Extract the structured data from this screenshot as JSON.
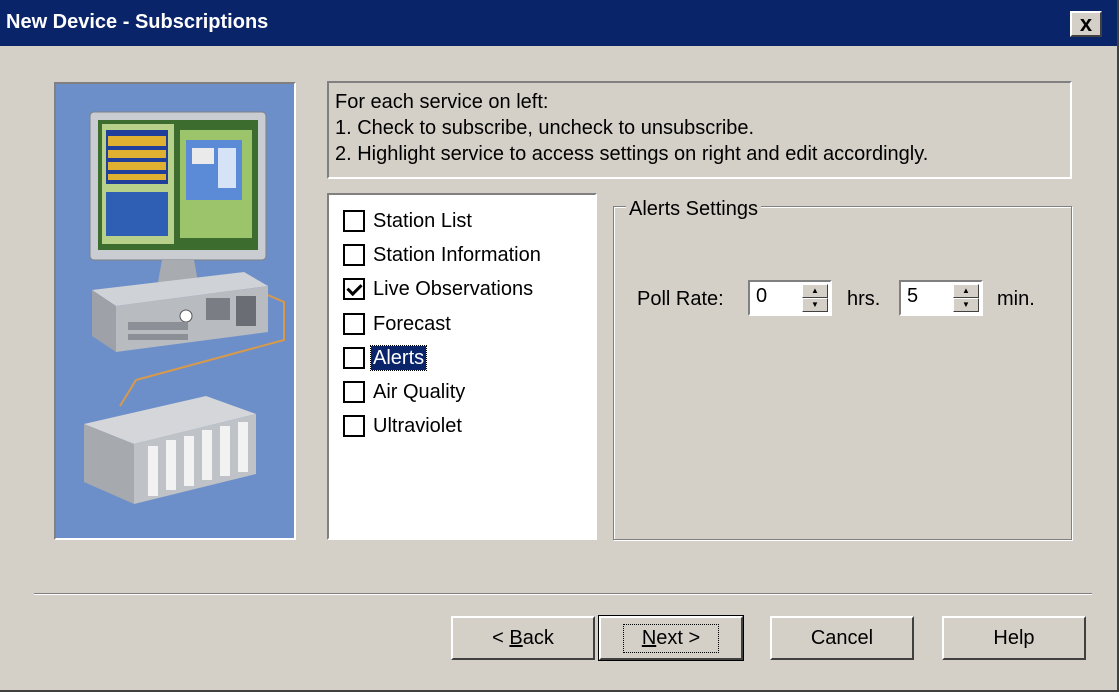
{
  "window": {
    "title": "New Device - Subscriptions",
    "close_glyph": "x"
  },
  "instructions": {
    "line1": "For each service on left:",
    "line2": "1. Check to subscribe, uncheck to unsubscribe.",
    "line3": "2. Highlight service to access settings on right and edit accordingly."
  },
  "services": [
    {
      "label": "Station List",
      "checked": false,
      "selected": false
    },
    {
      "label": "Station Information",
      "checked": false,
      "selected": false
    },
    {
      "label": "Live Observations",
      "checked": true,
      "selected": false
    },
    {
      "label": "Forecast",
      "checked": false,
      "selected": false
    },
    {
      "label": "Alerts",
      "checked": false,
      "selected": true
    },
    {
      "label": "Air Quality",
      "checked": false,
      "selected": false
    },
    {
      "label": "Ultraviolet",
      "checked": false,
      "selected": false
    }
  ],
  "settings": {
    "group_title": "Alerts Settings",
    "poll_rate_label": "Poll Rate:",
    "hours_value": "0",
    "hours_unit": "hrs.",
    "minutes_value": "5",
    "minutes_unit": "min."
  },
  "buttons": {
    "back": {
      "prefix": "< ",
      "mnemonic": "B",
      "rest": "ack"
    },
    "next": {
      "mnemonic": "N",
      "rest": "ext >"
    },
    "cancel": "Cancel",
    "help": "Help"
  },
  "colors": {
    "titlebar": "#0a246a",
    "face": "#d4d0c8",
    "selection": "#0a246a",
    "illustration_bg": "#6d8fc9"
  },
  "icons": {
    "illustration": "computer-plc-illustration",
    "close": "close-icon",
    "spin_up": "arrow-up-icon",
    "spin_down": "arrow-down-icon"
  }
}
